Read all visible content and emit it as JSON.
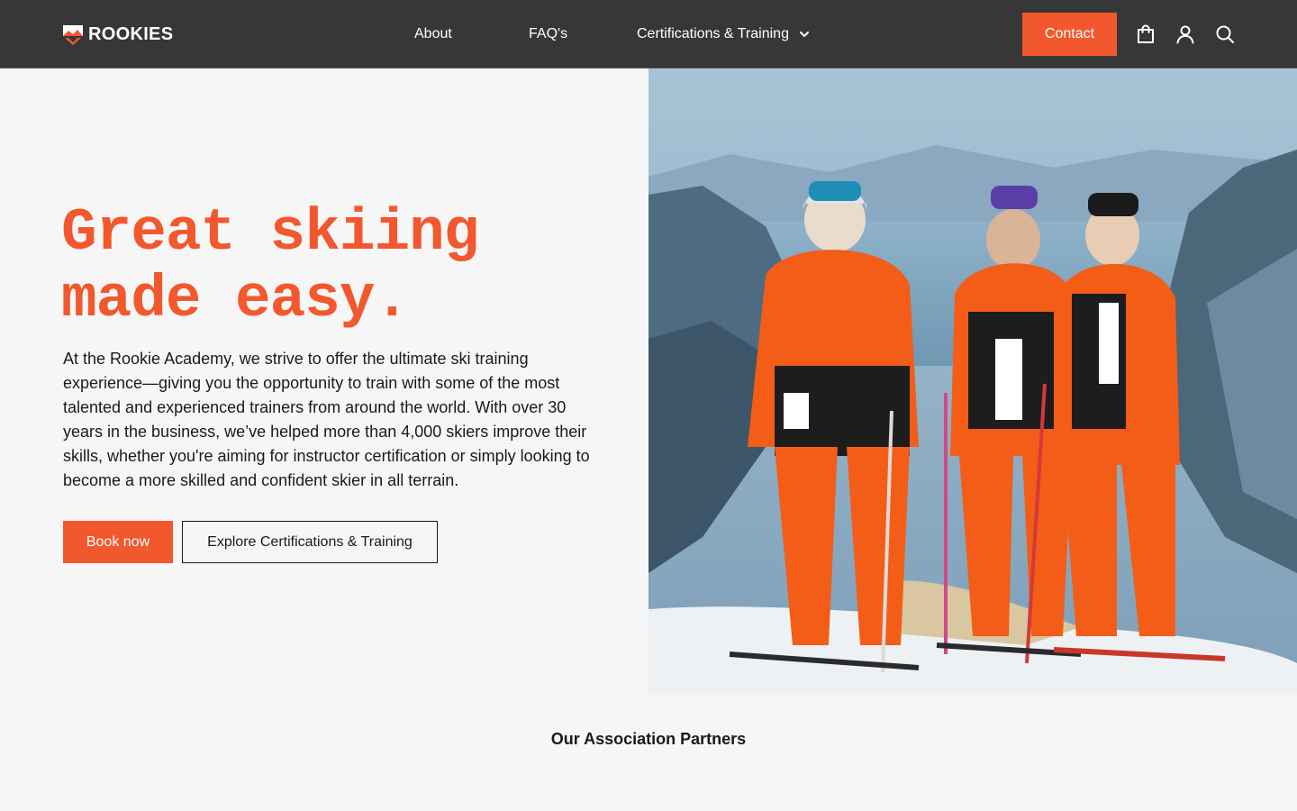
{
  "header": {
    "logo_text": "ROOKIES",
    "nav": {
      "about": "About",
      "faq": "FAQ's",
      "certifications": "Certifications & Training"
    },
    "contact_label": "Contact",
    "icons": [
      "shopping-bag-icon",
      "user-icon",
      "search-icon",
      "chevron-down-icon"
    ]
  },
  "hero": {
    "headline_line1": "Great skiing",
    "headline_line2": "made easy.",
    "intro": "At the Rookie Academy, we strive to offer the ultimate ski training experience—giving you the opportunity to train with some of the most talented and experienced trainers from around the world. With over 30 years in the business, we’ve helped more than 4,000 skiers improve their skills, whether you're aiming for instructor certification or simply looking to become a more skilled and confident skier in all terrain.",
    "book_label": "Book now",
    "explore_label": "Explore Certifications & Training"
  },
  "partners": {
    "heading": "Our Association Partners"
  },
  "colors": {
    "accent": "#f2582e",
    "header_bg": "#373737",
    "page_bg": "#f6f6f6",
    "text": "#1a1a1a"
  }
}
